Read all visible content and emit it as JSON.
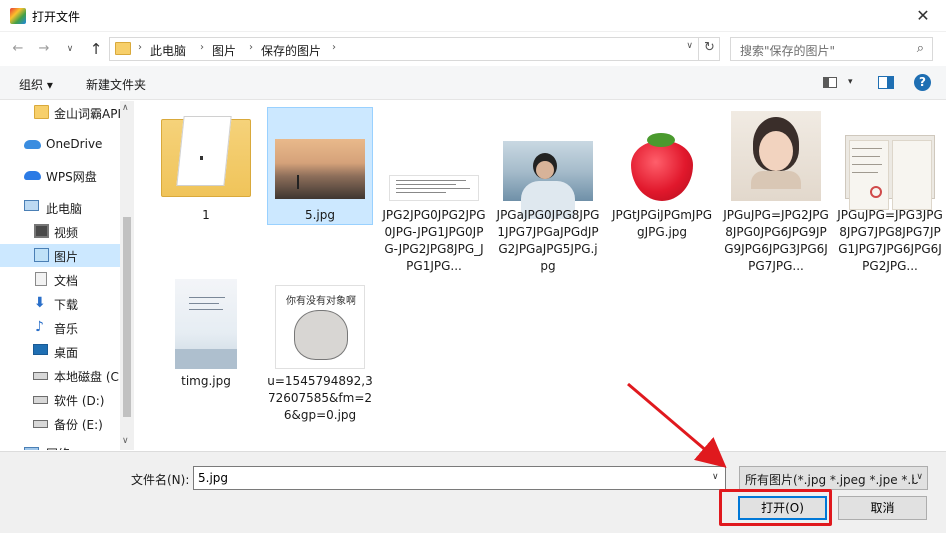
{
  "window": {
    "title": "打开文件",
    "close_glyph": "✕"
  },
  "address": {
    "back_glyph": "←",
    "forward_glyph": "→",
    "recent_glyph": "∨",
    "up_glyph": "↑",
    "breadcrumb": [
      "此电脑",
      "图片",
      "保存的图片"
    ],
    "sep_glyph": "›",
    "dropdown_glyph": "∨",
    "refresh_glyph": "↻"
  },
  "search": {
    "placeholder": "搜索\"保存的图片\"",
    "icon_glyph": "⌕"
  },
  "toolbar": {
    "organize_label": "组织 ▾",
    "new_folder_label": "新建文件夹",
    "view_dropdown_glyph": "▾",
    "help_glyph": "?"
  },
  "sidebar": {
    "items": [
      {
        "label": "金山词霸API",
        "icon": "folder-icon"
      },
      {
        "label": "OneDrive",
        "icon": "cloud-icon"
      },
      {
        "label": "WPS网盘",
        "icon": "wps-cloud-icon"
      },
      {
        "label": "此电脑",
        "icon": "computer-icon"
      },
      {
        "label": "视频",
        "icon": "video-icon"
      },
      {
        "label": "图片",
        "icon": "pictures-icon",
        "selected": true
      },
      {
        "label": "文档",
        "icon": "document-icon"
      },
      {
        "label": "下载",
        "icon": "download-icon",
        "glyph": "⬇"
      },
      {
        "label": "音乐",
        "icon": "music-icon",
        "glyph": "♪"
      },
      {
        "label": "桌面",
        "icon": "desktop-icon"
      },
      {
        "label": "本地磁盘 (C",
        "icon": "drive-icon"
      },
      {
        "label": "软件 (D:)",
        "icon": "drive-icon"
      },
      {
        "label": "备份 (E:)",
        "icon": "drive-icon"
      },
      {
        "label": "网络",
        "icon": "network-icon"
      }
    ],
    "scroll_up_glyph": "∧",
    "scroll_down_glyph": "∨"
  },
  "files": [
    {
      "name": "1",
      "type": "folder"
    },
    {
      "name": "5.jpg",
      "type": "image",
      "selected": true
    },
    {
      "name": "JPG2JPG0JPG2JPG0JPG-JPG1JPG0JPG-JPG2JPG8JPG_JPG1JPG...",
      "type": "image"
    },
    {
      "name": "JPGaJPG0JPG8JPG1JPG7JPGaJPGdJPG2JPGaJPG5JPG.jpg",
      "type": "image"
    },
    {
      "name": "JPGtJPGiJPGmJPGgJPG.jpg",
      "type": "image"
    },
    {
      "name": "JPGuJPG=JPG2JPG8JPG0JPG6JPG9JPG9JPG6JPG3JPG6JPG7JPG...",
      "type": "image"
    },
    {
      "name": "JPGuJPG=JPG3JPG8JPG7JPG8JPG7JPG1JPG7JPG6JPG6JPG2JPG...",
      "type": "image"
    },
    {
      "name": "timg.jpg",
      "type": "image"
    },
    {
      "name": "u=1545794892,372607585&fm=26&gp=0.jpg",
      "type": "image",
      "caption": "你有没有对象啊"
    }
  ],
  "bottom": {
    "filename_label": "文件名(N):",
    "filename_value": "5.jpg",
    "filename_dd_glyph": "∨",
    "filetype_value": "所有图片(*.jpg *.jpeg *.jpe *.b",
    "filetype_dd_glyph": "∨",
    "open_label": "打开(O)",
    "cancel_label": "取消"
  },
  "colors": {
    "accent": "#0078d7",
    "selection": "#cce8ff",
    "annotation": "#e0191e"
  }
}
